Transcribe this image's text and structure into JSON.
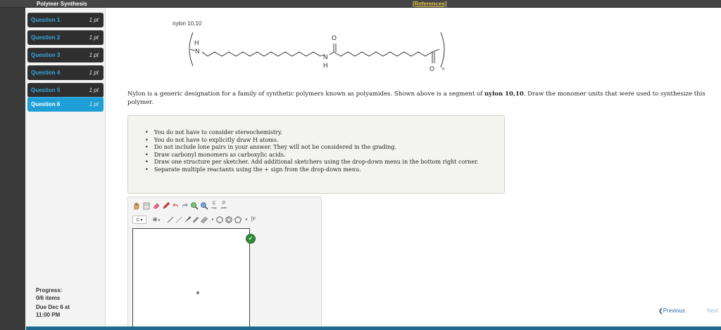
{
  "header": {
    "title": "Polymer Synthesis",
    "references": "[References]"
  },
  "sidebar": {
    "questions": [
      {
        "label": "Question 1",
        "points": "1 pt",
        "active": false
      },
      {
        "label": "Question 2",
        "points": "1 pt",
        "active": false
      },
      {
        "label": "Question 3",
        "points": "1 pt",
        "active": false
      },
      {
        "label": "Question 4",
        "points": "1 pt",
        "active": false
      },
      {
        "label": "Question 5",
        "points": "1 pt",
        "active": false
      },
      {
        "label": "Question 6",
        "points": "1 pt",
        "active": true
      }
    ],
    "progress_label": "Progress:",
    "progress_value": "0/6 items",
    "due_line1": "Due Dec 6 at",
    "due_line2": "11:00 PM"
  },
  "question": {
    "molecule_name": "nylon 10,10",
    "structure_atoms": {
      "n_left": "N",
      "h_left": "H",
      "n_mid": "N",
      "h_mid": "H",
      "o_top": "O",
      "o_bottom": "O",
      "repeat": "n"
    },
    "prompt_pre": "Nylon is a generic designation for a family of synthetic polymers known as polyamides. Shown above is a segment of ",
    "prompt_bold": "nylon 10,10",
    "prompt_post": ". Draw the monomer units that were used to synthesize this polymer.",
    "instructions": [
      "You do not have to consider stereochemistry.",
      "You do not have to explicitly draw H atoms.",
      "Do not include lone pairs in your answer. They will not be considered in the grading.",
      "Draw carbonyl monomers as carboxylic acids.",
      "Draw one structure per sketcher. Add additional sketchers using the drop-down menu in the bottom right corner.",
      "Separate multiple reactants using the + sign from the drop-down menu."
    ]
  },
  "sketcher": {
    "copy_label": "C",
    "copy_sub": "copy",
    "paste_label": "P",
    "paste_sub": "paste",
    "element_label": "C",
    "plus_label": "⊕",
    "bracket_label": "[",
    "bracket_label2": "F"
  },
  "nav": {
    "previous": "Previous",
    "next": "Next"
  },
  "colors": {
    "accent": "#1f9fd7",
    "sidebar_dark": "#2f2f2f",
    "link": "#2c6ea3",
    "bottom_bar": "#1d6a8e"
  }
}
